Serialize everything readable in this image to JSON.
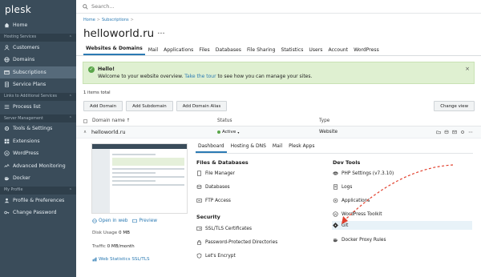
{
  "sidebar": {
    "logo": "plesk",
    "items_a": [
      {
        "label": "Home",
        "icon": "home-icon"
      }
    ],
    "section1": "Hosting Services",
    "items_b": [
      {
        "label": "Customers",
        "icon": "user-icon"
      },
      {
        "label": "Domains",
        "icon": "globe-icon"
      },
      {
        "label": "Subscriptions",
        "icon": "subscription-icon",
        "active": true
      },
      {
        "label": "Service Plans",
        "icon": "plan-icon"
      }
    ],
    "section2": "Links to Additional Services",
    "items_c": [
      {
        "label": "Process list",
        "icon": "list-icon"
      }
    ],
    "section3": "Server Management",
    "items_d": [
      {
        "label": "Tools & Settings",
        "icon": "tools-icon"
      },
      {
        "label": "Extensions",
        "icon": "extensions-icon"
      },
      {
        "label": "WordPress",
        "icon": "wordpress-icon"
      },
      {
        "label": "Advanced Monitoring",
        "icon": "monitoring-icon"
      },
      {
        "label": "Docker",
        "icon": "docker-icon"
      }
    ],
    "section4": "My Profile",
    "items_e": [
      {
        "label": "Profile & Preferences",
        "icon": "profile-icon"
      },
      {
        "label": "Change Password",
        "icon": "key-icon"
      }
    ]
  },
  "search": {
    "placeholder": "Search..."
  },
  "breadcrumb": {
    "home": "Home",
    "sep": ">",
    "current": "Subscriptions"
  },
  "page": {
    "title": "helloworld.ru",
    "more": "···"
  },
  "tabs": [
    "Websites & Domains",
    "Mail",
    "Applications",
    "Files",
    "Databases",
    "File Sharing",
    "Statistics",
    "Users",
    "Account",
    "WordPress"
  ],
  "hello": {
    "title": "Hello!",
    "text_before": "Welcome to your website overview. ",
    "link": "Take the tour",
    "text_after": " to see how you can manage your sites.",
    "close": "×"
  },
  "items_total": "1 items total",
  "toolbar": {
    "add_domain": "Add Domain",
    "add_subdomain": "Add Subdomain",
    "add_alias": "Add Domain Alias",
    "change_view": "Change view"
  },
  "table": {
    "col_domain": "Domain name ↑",
    "col_status": "Status",
    "col_type": "Type",
    "row": {
      "expand": "∧",
      "domain": "helloworld.ru",
      "status": "Active",
      "status_caret": "▾",
      "type": "Website"
    }
  },
  "detail": {
    "open_in_web": "Open in web",
    "preview": "Preview",
    "disk_label": "Disk Usage",
    "disk_value": "0 MB",
    "traffic_label": "Traffic",
    "traffic_value": "0 MB/month",
    "web_stats": "Web Statistics SSL/TLS",
    "tabs": [
      "Dashboard",
      "Hosting & DNS",
      "Mail",
      "Plesk Apps"
    ],
    "files_db": {
      "title": "Files & Databases",
      "items": [
        "File Manager",
        "Databases",
        "FTP Access"
      ]
    },
    "security": {
      "title": "Security",
      "items": [
        "SSL/TLS Certificates",
        "Password-Protected Directories",
        "Let's Encrypt"
      ]
    },
    "dev_tools": {
      "title": "Dev Tools",
      "items": [
        "PHP Settings (v7.3.10)",
        "Logs",
        "Applications",
        "WordPress Toolkit",
        "Git",
        "Docker Proxy Rules"
      ]
    }
  },
  "colors": {
    "sidebar": "#3a4c5a",
    "accent": "#2b7ab3",
    "success": "#5aa64a",
    "highlight_arrow": "#e2412e"
  }
}
